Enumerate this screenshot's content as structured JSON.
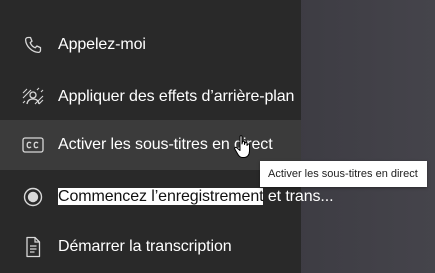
{
  "menu": {
    "items": [
      {
        "label": "Appelez-moi",
        "icon": "phone-icon"
      },
      {
        "label": "Appliquer des effets d’arrière-plan",
        "icon": "background-effects-icon"
      },
      {
        "label": "Activer les sous-titres en direct",
        "icon": "closed-captions-icon"
      },
      {
        "label_highlighted": "Commencez l’enregistrement",
        "label_rest": " et trans...",
        "icon": "record-icon"
      },
      {
        "label": "Démarrer la transcription",
        "icon": "transcript-icon"
      }
    ]
  },
  "tooltip": {
    "text": "Activer les sous-titres en direct"
  },
  "colors": {
    "menu_bg": "#292929",
    "hover_bg": "#3b3b3b",
    "text": "#ffffff",
    "tooltip_bg": "#ffffff"
  }
}
